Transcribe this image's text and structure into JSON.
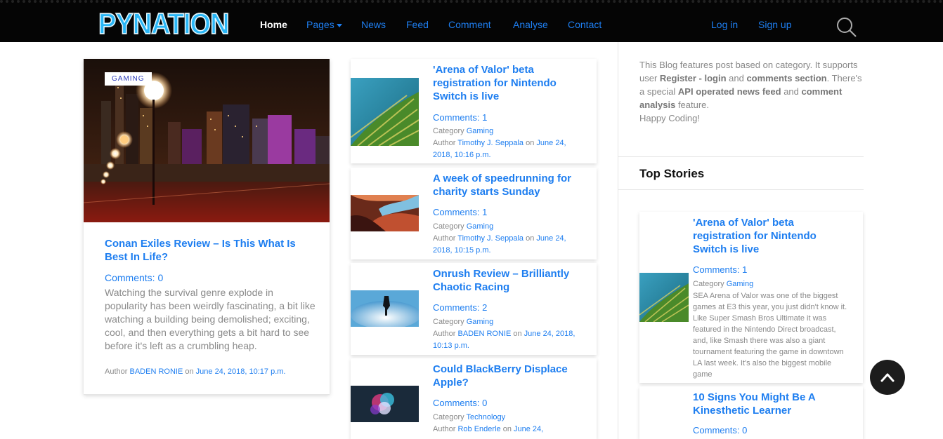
{
  "brand": {
    "logo": "PYNATION"
  },
  "nav": {
    "home": "Home",
    "pages": "Pages",
    "news": "News",
    "feed": "Feed",
    "comment": "Comment",
    "analyse": "Analyse",
    "contact": "Contact",
    "login": "Log in",
    "signup": "Sign up"
  },
  "featured": {
    "badge": "GAMING",
    "title": "Conan Exiles Review – Is This What Is Best In Life?",
    "comments": "Comments: 0",
    "excerpt": "Watching the survival genre explode in popularity has been weirdly fascinating, a bit like watching a building being demolished; exciting, cool, and then everything gets a bit hard to see before it's left as a crumbling heap.",
    "author_label": "Author",
    "author": "BADEN RONIE",
    "on": "on",
    "date": "June 24, 2018, 10:17 p.m."
  },
  "posts": [
    {
      "title": "'Arena of Valor' beta registration for Nintendo Switch is live",
      "comments": "Comments: 1",
      "category_label": "Category",
      "category": "Gaming",
      "author_label": "Author",
      "author": "Timothy J. Seppala",
      "on": "on",
      "date": "June 24, 2018, 10:16 p.m."
    },
    {
      "title": "A week of speedrunning for charity starts Sunday",
      "comments": "Comments: 1",
      "category_label": "Category",
      "category": "Gaming",
      "author_label": "Author",
      "author": "Timothy J. Seppala",
      "on": "on",
      "date": "June 24, 2018, 10:15 p.m."
    },
    {
      "title": "Onrush Review – Brilliantly Chaotic Racing",
      "comments": "Comments: 2",
      "category_label": "Category",
      "category": "Gaming",
      "author_label": "Author",
      "author": "BADEN RONIE",
      "on": "on",
      "date": "June 24, 2018, 10:13 p.m."
    },
    {
      "title": "Could BlackBerry Displace Apple?",
      "comments": "Comments: 0",
      "category_label": "Category",
      "category": "Technology",
      "author_label": "Author",
      "author": "Rob Enderle",
      "on": "on",
      "date": "June 24,"
    }
  ],
  "sidebar": {
    "about_1": "This Blog features post based on category. It supports user ",
    "about_b1": "Register - login",
    "about_2": " and ",
    "about_b2": "comments section",
    "about_3": ". There's a special ",
    "about_b3": "API operated news feed",
    "about_4": " and ",
    "about_b4": "comment analysis",
    "about_5": " feature.",
    "about_6": "Happy Coding!",
    "top_stories": "Top Stories",
    "stories": [
      {
        "title": "'Arena of Valor' beta registration for Nintendo Switch is live",
        "comments": "Comments: 1",
        "category_label": "Category",
        "category": "Gaming",
        "excerpt": "SEA Arena of Valor was one of the biggest games at E3 this year, you just didn't know it. Like Super Smash Bros Ultimate it was featured in the Nintendo Direct broadcast, and, like Smash there was also a giant tournament featuring the game in downtown LA last week. It's also the biggest mobile game"
      },
      {
        "title": "10 Signs You Might Be A Kinesthetic Learner",
        "comments": "Comments: 0"
      }
    ]
  },
  "icons": {
    "search": "search-icon",
    "scroll_top": "chevron-up-icon",
    "caret": "caret-down-icon"
  }
}
